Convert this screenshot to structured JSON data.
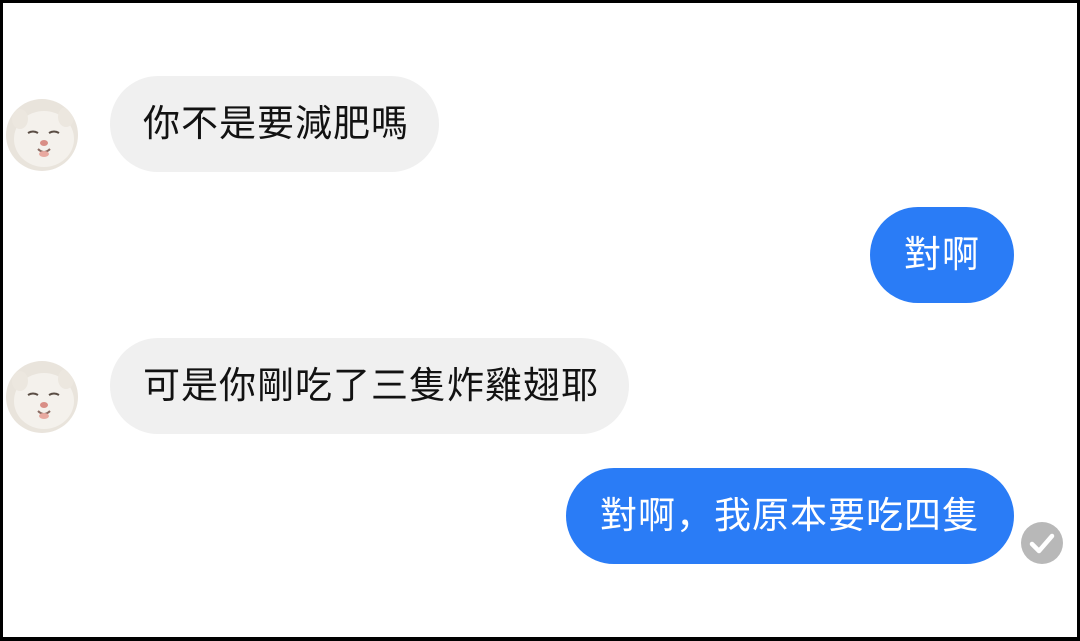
{
  "conversation": {
    "messages": [
      {
        "sender": "other",
        "text": "你不是要減肥嗎"
      },
      {
        "sender": "me",
        "text": "對啊"
      },
      {
        "sender": "other",
        "text": "可是你剛吃了三隻炸雞翅耶"
      },
      {
        "sender": "me",
        "text": "對啊，我原本要吃四隻"
      }
    ]
  },
  "colors": {
    "outgoing_bubble": "#2a7cf6",
    "incoming_bubble": "#f0f0f0",
    "seen_indicator": "#b8b8b8"
  },
  "icons": {
    "avatar": "cat-avatar-icon",
    "seen": "check-circle-icon"
  }
}
